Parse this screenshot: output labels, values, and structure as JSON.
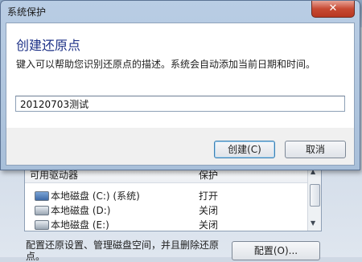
{
  "background": {
    "list": {
      "columns": [
        "可用驱动器",
        "保护"
      ],
      "rows": [
        {
          "drive": "本地磁盘 (C:) (系统)",
          "status": "打开",
          "icon": "system-drive-icon"
        },
        {
          "drive": "本地磁盘 (D:)",
          "status": "关闭",
          "icon": "drive-icon"
        },
        {
          "drive": "本地磁盘 (E:)",
          "status": "关闭",
          "icon": "drive-icon"
        }
      ]
    },
    "description": "配置还原设置、管理磁盘空间，并且删除还原点。",
    "config_button": "配置(O)..."
  },
  "dialog": {
    "title": "系统保护",
    "close_glyph": "✕",
    "heading": "创建还原点",
    "instruction": "键入可以帮助您识别还原点的描述。系统会自动添加当前日期和时间。",
    "input_value": "20120703测试",
    "create_button": "创建(C)",
    "cancel_button": "取消"
  },
  "colors": {
    "heading": "#1e3287",
    "close_button": "#c74a33",
    "title_bar": "#b9cde4"
  }
}
